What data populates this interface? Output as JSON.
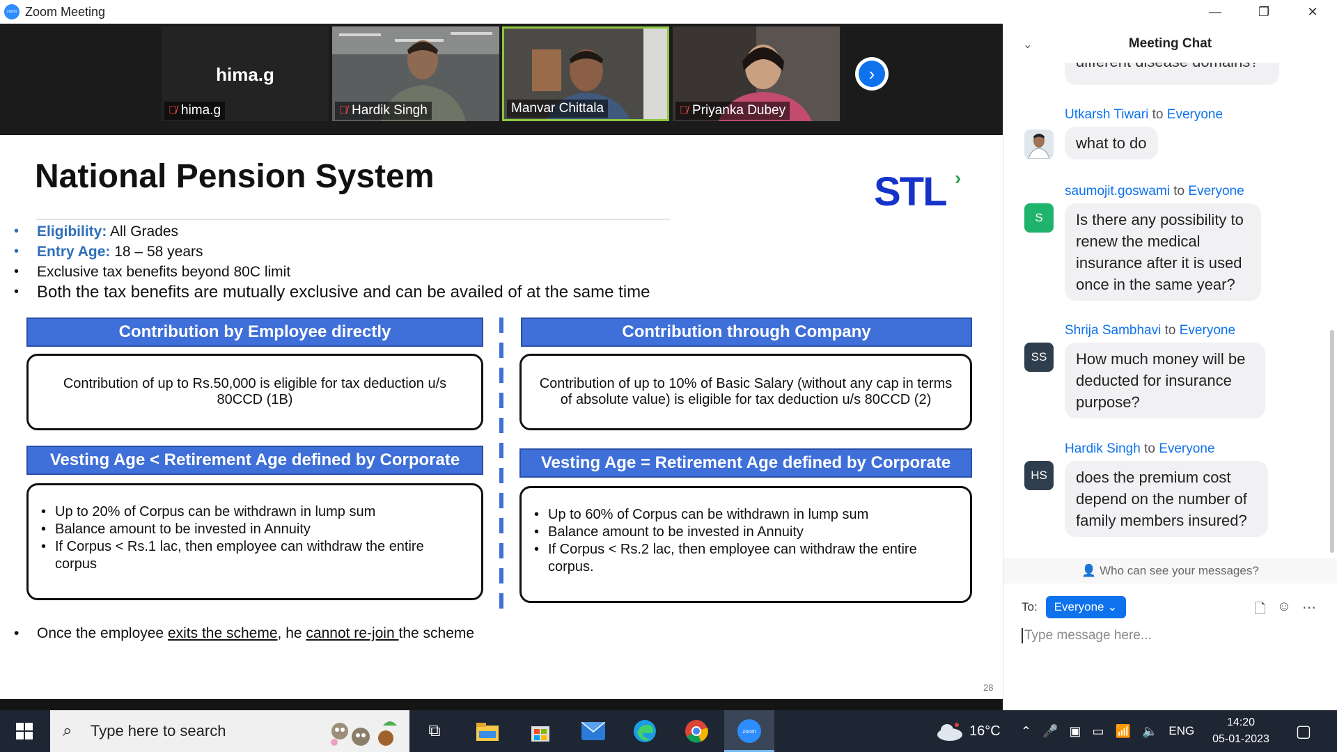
{
  "window": {
    "title": "Zoom Meeting",
    "controls": [
      "—",
      "❐",
      "✕"
    ]
  },
  "video_strip": {
    "tiles": [
      {
        "big_name": "hima.g",
        "label": "hima.g",
        "muted": true
      },
      {
        "label": "Hardik Singh",
        "muted": true
      },
      {
        "label": "Manvar Chittala",
        "muted": false,
        "active": true
      },
      {
        "label": "Priyanka Dubey",
        "muted": true
      }
    ],
    "next_icon": "›"
  },
  "slide": {
    "title": "National Pension System",
    "logo_text": "STL",
    "bullets": [
      {
        "label": "Eligibility:",
        "text": " All Grades"
      },
      {
        "label": "Entry Age:",
        "text": " 18 – 58 years"
      },
      {
        "text": "Exclusive tax benefits beyond 80C limit"
      },
      {
        "text": "Both the tax benefits are mutually exclusive and can be availed of at the same time"
      }
    ],
    "left_header_1": "Contribution by Employee directly",
    "left_box_1": "Contribution of up to Rs.50,000 is eligible for tax deduction u/s 80CCD (1B)",
    "right_header_1": "Contribution through Company",
    "right_box_1": "Contribution of up to 10% of Basic Salary (without any cap in terms of absolute value) is eligible for tax deduction u/s 80CCD (2)",
    "left_header_2": "Vesting Age < Retirement Age defined by Corporate",
    "left_box_2": [
      "Up to 20% of Corpus can be withdrawn in lump sum",
      "Balance amount to be invested in Annuity",
      "If Corpus < Rs.1 lac, then employee can withdraw the entire corpus"
    ],
    "right_header_2": "Vesting Age = Retirement Age defined by Corporate",
    "right_box_2": [
      "Up to 60% of Corpus can be withdrawn in lump sum",
      "Balance amount to be invested in Annuity",
      "If Corpus < Rs.2 lac, then employee can withdraw the entire corpus."
    ],
    "footer": {
      "a": "Once the employee ",
      "b": "exits the scheme",
      "c": ", he ",
      "d": "cannot re-join ",
      "e": "the scheme"
    },
    "page_number": "28"
  },
  "chat": {
    "title": "Meeting Chat",
    "cut_text": "different disease domains?",
    "to_word": " to ",
    "messages": [
      {
        "sender": "Utkarsh Tiwari",
        "recipient": "Everyone",
        "avatar": "",
        "text": "what to do"
      },
      {
        "sender": "saumojit.goswami",
        "recipient": "Everyone",
        "avatar": "S",
        "text": "Is there any possibility to renew the medical insurance after it is used once in the same year?"
      },
      {
        "sender": "Shrija Sambhavi",
        "recipient": "Everyone",
        "avatar": "SS",
        "text": "How much money will be deducted for insurance purpose?"
      },
      {
        "sender": "Hardik Singh",
        "recipient": "Everyone",
        "avatar": "HS",
        "text": "does the premium cost depend on the number of family members insured?"
      }
    ],
    "who_can_see": "Who can see your messages?",
    "to_label": "To:",
    "to_value": "Everyone",
    "placeholder": "Type message here..."
  },
  "taskbar": {
    "search_placeholder": "Type here to search",
    "weather": "16°C",
    "language": "ENG",
    "time": "14:20",
    "date": "05-01-2023"
  }
}
